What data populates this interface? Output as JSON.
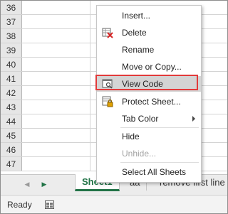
{
  "grid": {
    "rows": [
      "36",
      "37",
      "38",
      "39",
      "40",
      "41",
      "42",
      "43",
      "44",
      "45",
      "46",
      "47"
    ]
  },
  "tabs": {
    "nav_prev_icon": "triangle-left-icon",
    "nav_next_icon": "triangle-right-icon",
    "items": [
      "Sheet1",
      "aa",
      "remove first line"
    ],
    "active_index": 0
  },
  "status": {
    "ready": "Ready",
    "macro_icon": "macro-record-icon"
  },
  "context_menu": {
    "items": [
      {
        "label": "Insert...",
        "icon": "none"
      },
      {
        "label": "Delete",
        "icon": "delete-sheet-icon"
      },
      {
        "label": "Rename",
        "icon": "none"
      },
      {
        "label": "Move or Copy...",
        "icon": "none"
      },
      {
        "label": "View Code",
        "icon": "view-code-icon"
      },
      {
        "label": "Protect Sheet...",
        "icon": "protect-sheet-icon"
      },
      {
        "label": "Tab Color",
        "icon": "none"
      },
      {
        "label": "Hide",
        "icon": "none"
      },
      {
        "label": "Unhide...",
        "icon": "none"
      },
      {
        "label": "Select All Sheets",
        "icon": "none"
      }
    ],
    "highlighted": "View Code",
    "highlight_border_color": "#e23a3a"
  },
  "colors": {
    "accent": "#217346",
    "header_bg": "#e6e6e6",
    "gridline": "#d4d4d4"
  }
}
